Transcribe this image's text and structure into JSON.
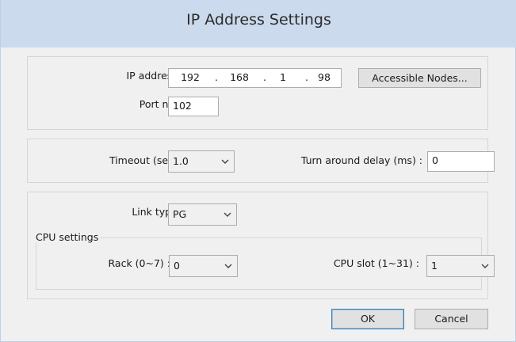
{
  "window": {
    "title": "IP Address Settings"
  },
  "ip_section": {
    "ip_label": "IP address :",
    "ip_segments": [
      "192",
      "168",
      "1",
      "98"
    ],
    "ip_separator": ".",
    "accessible_nodes_button": "Accessible Nodes...",
    "port_label": "Port no. :",
    "port_value": "102"
  },
  "timing_section": {
    "timeout_label": "Timeout (sec) :",
    "timeout_value": "1.0",
    "turnaround_label": "Turn around delay (ms) :",
    "turnaround_value": "0"
  },
  "link_section": {
    "link_type_label": "Link type :",
    "link_type_value": "PG",
    "cpu_settings_legend": "CPU settings",
    "rack_label": "Rack (0~7) :",
    "rack_value": "0",
    "cpu_slot_label": "CPU slot (1~31) :",
    "cpu_slot_value": "1"
  },
  "footer": {
    "ok_label": "OK",
    "cancel_label": "Cancel"
  },
  "icons": {
    "dropdown": "chevron-down-icon"
  }
}
